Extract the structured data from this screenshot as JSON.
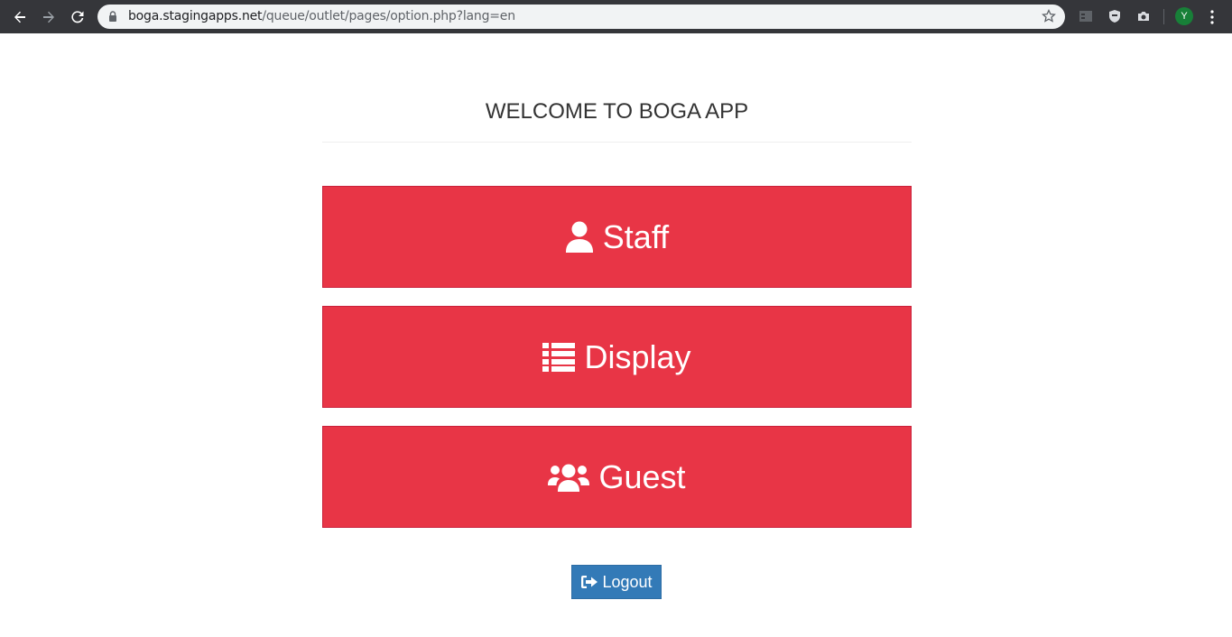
{
  "browser": {
    "url_host": "boga.stagingapps.net",
    "url_path": "/queue/outlet/pages/option.php?lang=en",
    "profile_initial": "Y"
  },
  "page": {
    "title": "WELCOME TO BOGA APP"
  },
  "options": {
    "staff_label": "Staff",
    "display_label": "Display",
    "guest_label": "Guest"
  },
  "logout_label": "Logout",
  "colors": {
    "option_button_bg": "#e83546",
    "logout_button_bg": "#337ab7",
    "chrome_bg": "#35363a"
  },
  "icons": {
    "staff": "user-icon",
    "display": "list-icon",
    "guest": "users-icon",
    "logout": "sign-out-icon"
  }
}
